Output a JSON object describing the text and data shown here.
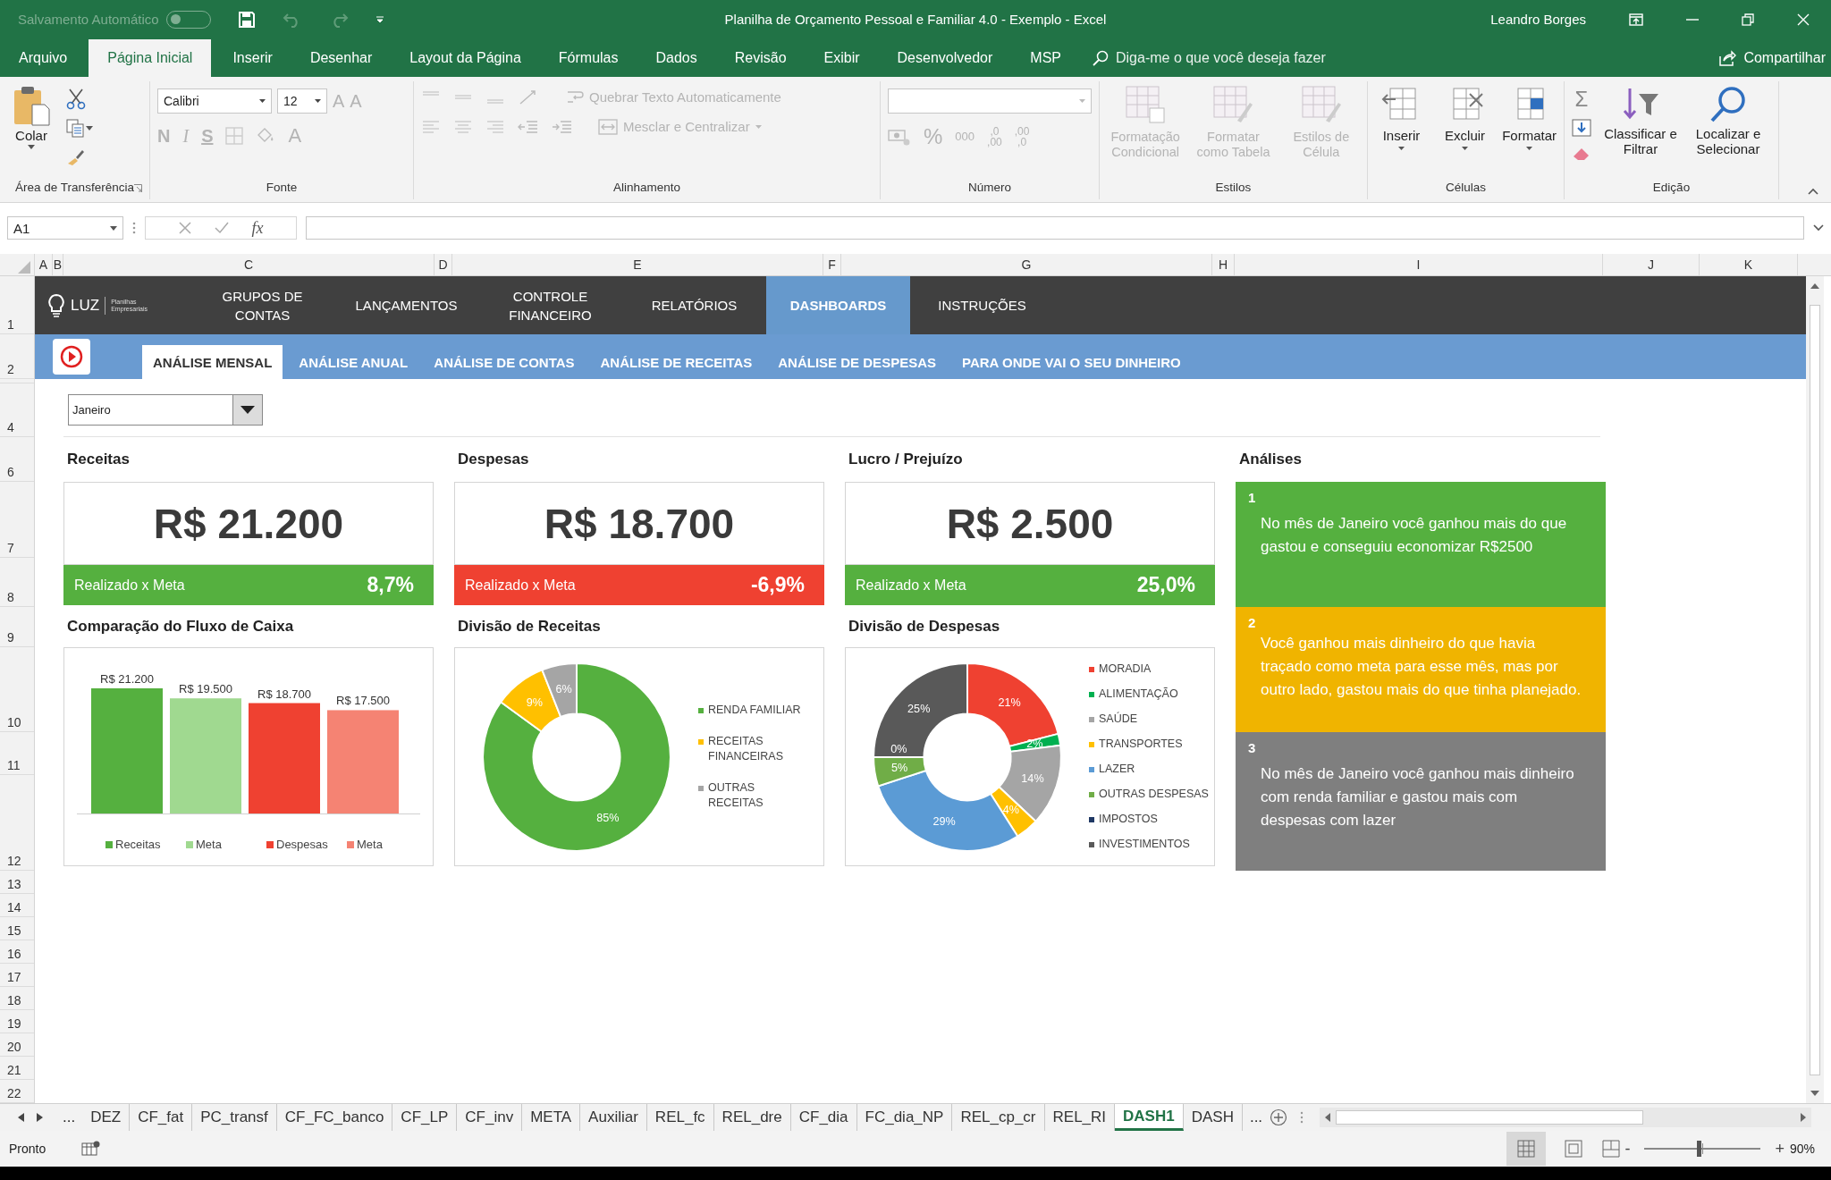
{
  "title_bar": {
    "autosave_label": "Salvamento Automático",
    "autosave_on": false,
    "title": "Planilha de Orçamento Pessoal e Familiar 4.0 - Exemplo  -  Excel",
    "user": "Leandro Borges"
  },
  "ribbon_tabs": [
    {
      "label": "Arquivo",
      "selected": false
    },
    {
      "label": "Página Inicial",
      "selected": true
    },
    {
      "label": "Inserir",
      "selected": false
    },
    {
      "label": "Desenhar",
      "selected": false
    },
    {
      "label": "Layout da Página",
      "selected": false
    },
    {
      "label": "Fórmulas",
      "selected": false
    },
    {
      "label": "Dados",
      "selected": false
    },
    {
      "label": "Revisão",
      "selected": false
    },
    {
      "label": "Exibir",
      "selected": false
    },
    {
      "label": "Desenvolvedor",
      "selected": false
    },
    {
      "label": "MSP",
      "selected": false
    }
  ],
  "tell_me": {
    "placeholder": "Diga-me o que você deseja fazer"
  },
  "share_label": "Compartilhar",
  "ribbon": {
    "clipboard": {
      "label": "Área de Transferência",
      "paste": "Colar"
    },
    "font": {
      "label": "Fonte",
      "font_name": "Calibri",
      "font_size": "12",
      "grow": "A",
      "shrink": "A",
      "bold": "N",
      "italic": "I",
      "underline": "S",
      "font_color": "A"
    },
    "alignment": {
      "label": "Alinhamento",
      "wrap": {
        "label": "Quebrar Texto Automaticamente",
        "disabled": true
      },
      "merge": {
        "label": "Mesclar e Centralizar",
        "disabled": true
      }
    },
    "number": {
      "label": "Número",
      "percent": "%",
      "thousands": "000",
      "increase_decimal": [
        ",0",
        ",00"
      ],
      "decrease_decimal": [
        ",00",
        ",0"
      ]
    },
    "styles": {
      "label": "Estilos",
      "buttons": [
        {
          "label": "Formatação Condicional",
          "disabled": true
        },
        {
          "label": "Formatar como Tabela",
          "disabled": true
        },
        {
          "label": "Estilos de Célula",
          "disabled": true
        }
      ]
    },
    "cells": {
      "label": "Células",
      "buttons": [
        {
          "label": "Inserir",
          "disabled": false
        },
        {
          "label": "Excluir",
          "disabled": false
        },
        {
          "label": "Formatar",
          "disabled": false
        }
      ]
    },
    "editing": {
      "label": "Edição",
      "autosum": "Σ",
      "buttons": [
        {
          "label": "Classificar e Filtrar",
          "disabled": false
        },
        {
          "label": "Localizar e Selecionar",
          "disabled": false
        }
      ]
    }
  },
  "formula_bar": {
    "name_box": "A1",
    "fx": "fx"
  },
  "columns": [
    "A",
    "B",
    "C",
    "D",
    "E",
    "F",
    "G",
    "H",
    "I",
    "J",
    "K"
  ],
  "rows": [
    "1",
    "2",
    "4",
    "6",
    "7",
    "8",
    "9",
    "10",
    "11",
    "12",
    "13",
    "14",
    "15",
    "16",
    "17",
    "18",
    "19",
    "20",
    "21",
    "22"
  ],
  "nav": {
    "logo": "LUZ",
    "logo_sub": "Planilhas Empresariais",
    "items": [
      {
        "label": "GRUPOS DE CONTAS",
        "selected": false
      },
      {
        "label": "LANÇAMENTOS",
        "selected": false
      },
      {
        "label": "CONTROLE FINANCEIRO",
        "selected": false
      },
      {
        "label": "RELATÓRIOS",
        "selected": false
      },
      {
        "label": "DASHBOARDS",
        "selected": true
      },
      {
        "label": "INSTRUÇÕES",
        "selected": false
      }
    ]
  },
  "subnav": [
    {
      "label": "ANÁLISE MENSAL",
      "selected": true
    },
    {
      "label": "ANÁLISE ANUAL",
      "selected": false
    },
    {
      "label": "ANÁLISE DE CONTAS",
      "selected": false
    },
    {
      "label": "ANÁLISE DE RECEITAS",
      "selected": false
    },
    {
      "label": "ANÁLISE DE DESPESAS",
      "selected": false
    },
    {
      "label": "PARA ONDE VAI O SEU DINHEIRO",
      "selected": false
    }
  ],
  "month_select": {
    "value": "Janeiro"
  },
  "kpis": [
    {
      "title": "Receitas",
      "value": "R$ 21.200",
      "meta_label": "Realizado x Meta",
      "meta_value": "8,7%",
      "color": "#55b03f"
    },
    {
      "title": "Despesas",
      "value": "R$ 18.700",
      "meta_label": "Realizado x Meta",
      "meta_value": "-6,9%",
      "color": "#ef4131"
    },
    {
      "title": "Lucro / Prejuízo",
      "value": "R$ 2.500",
      "meta_label": "Realizado x Meta",
      "meta_value": "25,0%",
      "color": "#55b03f"
    }
  ],
  "charts": [
    {
      "title": "Comparação do Fluxo de Caixa",
      "chart_data": {
        "type": "bar",
        "series": [
          {
            "name": "Receitas",
            "color": "#55b03f",
            "values": [
              21200
            ],
            "value_labels": [
              "R$ 21.200"
            ]
          },
          {
            "name": "Meta",
            "color": "#a0d990",
            "values": [
              19500
            ],
            "value_labels": [
              "R$ 19.500"
            ]
          },
          {
            "name": "Despesas",
            "color": "#ef4131",
            "values": [
              18700
            ],
            "value_labels": [
              "R$ 18.700"
            ]
          },
          {
            "name": "Meta",
            "color": "#f58373",
            "values": [
              17500
            ],
            "value_labels": [
              "R$ 17.500"
            ]
          }
        ],
        "data_labels": true,
        "legend": true
      }
    },
    {
      "title": "Divisão de Receitas",
      "chart_data": {
        "type": "donut",
        "categories": [
          "RENDA FAMILIAR",
          "RECEITAS FINANCEIRAS",
          "OUTRAS RECEITAS"
        ],
        "values": [
          85,
          9,
          6
        ],
        "colors": [
          "#55b03f",
          "#ffc000",
          "#a5a5a5"
        ],
        "data_labels": true,
        "value_labels": [
          "85%",
          "9%",
          "6%"
        ],
        "legend": true
      }
    },
    {
      "title": "Divisão de Despesas",
      "chart_data": {
        "type": "donut",
        "categories": [
          "MORADIA",
          "ALIMENTAÇÃO",
          "SAÚDE",
          "TRANSPORTES",
          "LAZER",
          "OUTRAS DESPESAS",
          "IMPOSTOS",
          "INVESTIMENTOS"
        ],
        "values": [
          21,
          2,
          14,
          4,
          29,
          5,
          0,
          25
        ],
        "colors": [
          "#ef4131",
          "#00b050",
          "#a5a5a5",
          "#ffc000",
          "#5b9bd5",
          "#70ad47",
          "#1f3864",
          "#595959"
        ],
        "data_labels": true,
        "value_labels": [
          "21%",
          "2%",
          "14%",
          "4%",
          "29%",
          "5%",
          "0%",
          "25%"
        ],
        "legend": true
      }
    }
  ],
  "analyses": {
    "title": "Análises",
    "items": [
      {
        "number": "1",
        "text": "No mês de Janeiro você ganhou mais do que gastou e conseguiu economizar R$2500",
        "color": "#55b03f"
      },
      {
        "number": "2",
        "text": "Você ganhou mais dinheiro do que havia traçado como meta para esse mês, mas por outro lado, gastou mais do que tinha planejado.",
        "color": "#f0b400"
      },
      {
        "number": "3",
        "text": "No mês de Janeiro você ganhou mais dinheiro com renda familiar e gastou mais com despesas com lazer",
        "color": "#7f7f7f"
      }
    ]
  },
  "sheet_tabs": {
    "more_left": "...",
    "items": [
      {
        "label": "DEZ",
        "selected": false
      },
      {
        "label": "CF_fat",
        "selected": false
      },
      {
        "label": "PC_transf",
        "selected": false
      },
      {
        "label": "CF_FC_banco",
        "selected": false
      },
      {
        "label": "CF_LP",
        "selected": false
      },
      {
        "label": "CF_inv",
        "selected": false
      },
      {
        "label": "META",
        "selected": false
      },
      {
        "label": "Auxiliar",
        "selected": false
      },
      {
        "label": "REL_fc",
        "selected": false
      },
      {
        "label": "REL_dre",
        "selected": false
      },
      {
        "label": "CF_dia",
        "selected": false
      },
      {
        "label": "FC_dia_NP",
        "selected": false
      },
      {
        "label": "REL_cp_cr",
        "selected": false
      },
      {
        "label": "REL_RI",
        "selected": false
      },
      {
        "label": "DASH1",
        "selected": true
      },
      {
        "label": "DASH",
        "selected": false
      }
    ],
    "more_right": "..."
  },
  "status_bar": {
    "status": "Pronto",
    "zoom_minus": "-",
    "zoom_plus": "+",
    "zoom_slider": {
      "level": 0.47
    },
    "zoom": "90%"
  }
}
